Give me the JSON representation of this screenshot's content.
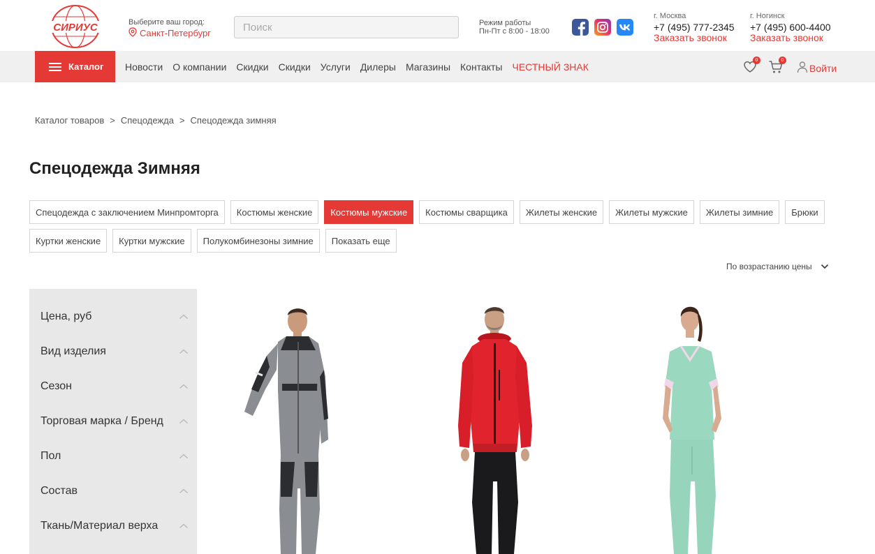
{
  "header": {
    "logo_text": "СИРИУС",
    "city_label": "Выберите ваш город:",
    "city_value": "Санкт-Петербург",
    "search_placeholder": "Поиск",
    "hours_label": "Режим работы",
    "hours_value": "Пн-Пт с 8:00 - 18:00",
    "social": [
      "facebook-icon",
      "instagram-icon",
      "vk-icon"
    ],
    "phones": [
      {
        "city": "г. Москва",
        "phone": "+7 (495) 777-2345",
        "callback": "Заказать звонок"
      },
      {
        "city": "г. Ногинск",
        "phone": "+7 (495) 600-4400",
        "callback": "Заказать звонок"
      }
    ]
  },
  "nav": {
    "catalog_label": "Каталог",
    "links": [
      "Новости",
      "О компании",
      "Скидки",
      "Скидки",
      "Услуги",
      "Дилеры",
      "Магазины",
      "Контакты"
    ],
    "highlight_link": "ЧЕСТНЫЙ ЗНАК",
    "favorites_count": "0",
    "cart_count": "0",
    "login_label": "Войти"
  },
  "breadcrumb": [
    "Каталог товаров",
    "Спецодежда",
    "Спецодежда зимняя"
  ],
  "breadcrumb_separator": ">",
  "page_title": "Спецодежда Зимняя",
  "categories": [
    {
      "label": "Спецодежда с заключением Минпромторга",
      "active": false
    },
    {
      "label": "Костюмы женские",
      "active": false
    },
    {
      "label": "Костюмы мужские",
      "active": true
    },
    {
      "label": "Костюмы сварщика",
      "active": false
    },
    {
      "label": "Жилеты женские",
      "active": false
    },
    {
      "label": "Жилеты мужские",
      "active": false
    },
    {
      "label": "Жилеты зимние",
      "active": false
    },
    {
      "label": "Брюки",
      "active": false
    },
    {
      "label": "Куртки женские",
      "active": false
    },
    {
      "label": "Куртки мужские",
      "active": false
    },
    {
      "label": "Полукомбинезоны зимние",
      "active": false
    },
    {
      "label": "Показать еще",
      "active": false
    }
  ],
  "sort": {
    "label": "По возрастанию цены"
  },
  "filters": [
    "Цена, руб",
    "Вид изделия",
    "Сезон",
    "Торговая марка / Бренд",
    "Пол",
    "Состав",
    "Ткань/Материал верха"
  ],
  "products": [
    {
      "image": "grey-black-workwear-suit"
    },
    {
      "image": "red-softshell-jacket-black-pants"
    },
    {
      "image": "mint-green-medical-uniform"
    }
  ],
  "colors": {
    "accent": "#e53935",
    "nav_bg": "#f0f0f0",
    "sidebar_bg": "#e8e8e8"
  }
}
